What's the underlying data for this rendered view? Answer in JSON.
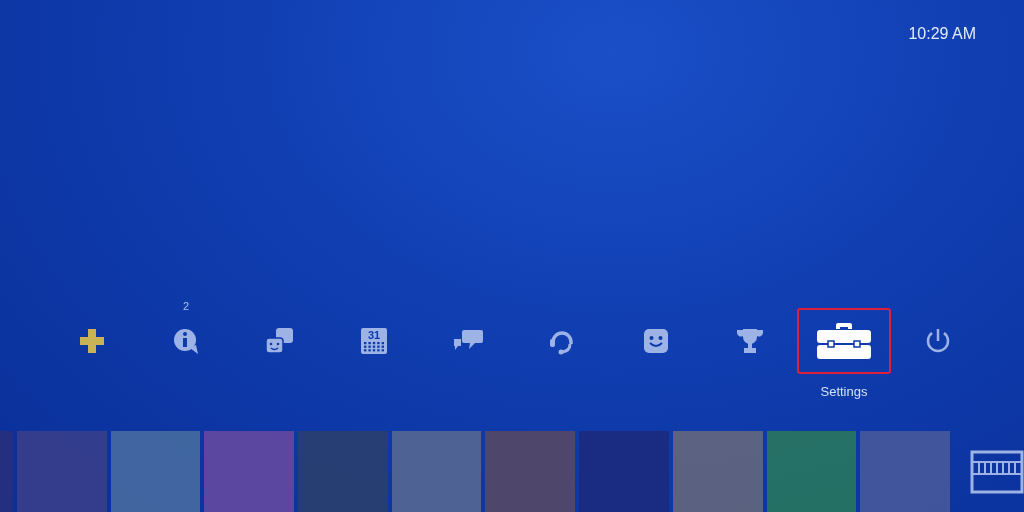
{
  "status_bar": {
    "time": "10:29 AM"
  },
  "function_bar": [
    {
      "kind": "plus",
      "selected": false
    },
    {
      "kind": "info",
      "selected": false,
      "badge": "2"
    },
    {
      "kind": "friends",
      "selected": false
    },
    {
      "kind": "calendar",
      "selected": false,
      "icon_text": "31"
    },
    {
      "kind": "messages",
      "selected": false
    },
    {
      "kind": "headset",
      "selected": false
    },
    {
      "kind": "face",
      "selected": false
    },
    {
      "kind": "trophy",
      "selected": false
    },
    {
      "kind": "settings",
      "selected": true,
      "label": "Settings"
    },
    {
      "kind": "power",
      "selected": false
    }
  ]
}
